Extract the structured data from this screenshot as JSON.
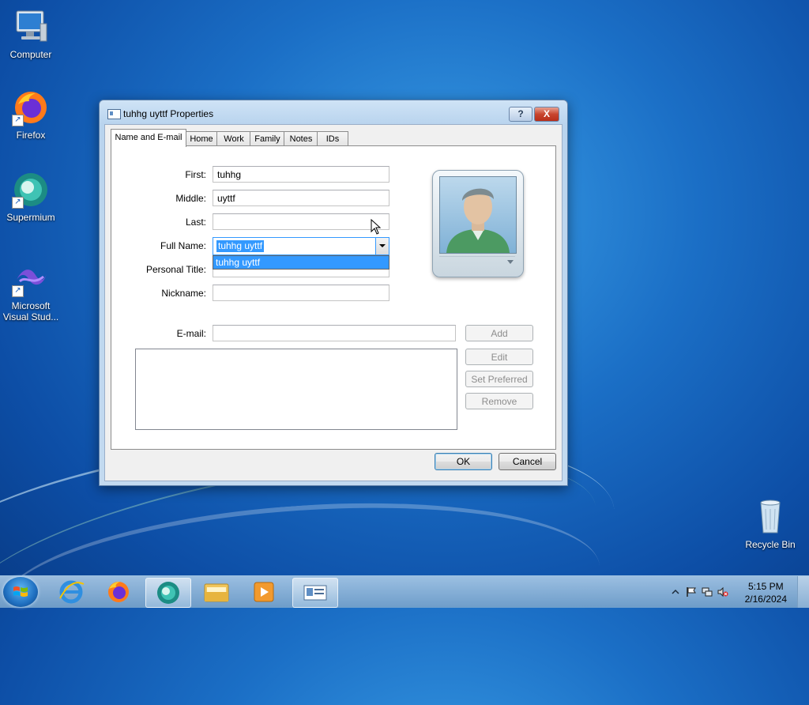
{
  "desktop": {
    "icons": [
      {
        "label": "Computer",
        "icon": "computer-icon"
      },
      {
        "label": "Firefox",
        "icon": "firefox-icon"
      },
      {
        "label": "Supermium",
        "icon": "supermium-icon"
      },
      {
        "label": "Microsoft Visual Stud...",
        "icon": "visual-studio-icon"
      },
      {
        "label": "Recycle Bin",
        "icon": "recycle-bin-icon"
      }
    ]
  },
  "dialog": {
    "title": "tuhhg uyttf Properties",
    "help_label": "?",
    "close_label": "X",
    "tabs": [
      "Name and E-mail",
      "Home",
      "Work",
      "Family",
      "Notes",
      "IDs"
    ],
    "active_tab": "Name and E-mail",
    "fields": {
      "first_label": "First:",
      "first_value": "tuhhg",
      "middle_label": "Middle:",
      "middle_value": "uyttf",
      "last_label": "Last:",
      "last_value": "",
      "full_name_label": "Full Name:",
      "full_name_value": "tuhhg uyttf",
      "full_name_options": [
        "tuhhg uyttf"
      ],
      "personal_title_label": "Personal Title:",
      "personal_title_value": "",
      "nickname_label": "Nickname:",
      "nickname_value": "",
      "email_label": "E-mail:",
      "email_value": ""
    },
    "email_buttons": {
      "add": "Add",
      "edit": "Edit",
      "set_preferred": "Set Preferred",
      "remove": "Remove"
    },
    "footer": {
      "ok": "OK",
      "cancel": "Cancel"
    }
  },
  "taskbar": {
    "items": [
      "internet-explorer-icon",
      "firefox-icon",
      "supermium-icon",
      "file-explorer-icon",
      "media-player-icon",
      "contacts-icon"
    ],
    "clock_time": "5:15 PM",
    "clock_date": "2/16/2024"
  },
  "colors": {
    "accent": "#3399ff",
    "desktop": "#1b6fc6"
  }
}
